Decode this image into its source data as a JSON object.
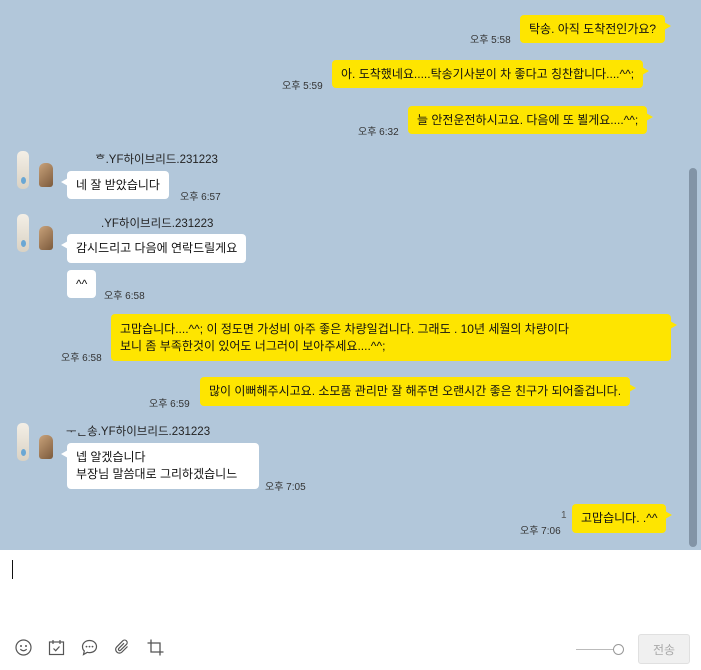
{
  "messages": {
    "m1": {
      "text": "탁송. 아직 도착전인가요?",
      "time": "오후 5:58"
    },
    "m2": {
      "text": "아. 도착했네요.....탁송기사분이   차 좋다고 칭찬합니다....^^;",
      "time": "오후 5:59"
    },
    "m3": {
      "text": "늘 안전운전하시고요. 다음에  또 뵐게요....^^;",
      "time": "오후 6:32"
    },
    "g1": {
      "sender": "ᄒ.YF하이브리드.231223",
      "text": "네 잘 받았습니다",
      "time": "오후 6:57"
    },
    "g2": {
      "sender": ".YF하이브리드.231223",
      "text1": "감시드리고 다음에 연락드릴게요",
      "text2": "^^",
      "time": "오후 6:58"
    },
    "m4": {
      "line1": "고맙습니다....^^;       이 정도면   가성비 아주 좋은 차량일겁니다.      그래도 . 10년 세월의 차량이다",
      "line2": "보니     좀 부족한것이 있어도  너그러이 보아주세요....^^;",
      "time": "오후 6:58"
    },
    "m5": {
      "text": "많이 이뻐해주시고요.   소모품 관리만 잘 해주면 오랜시간 좋은 친구가 되어줄겁니다.",
      "time": "오후 6:59"
    },
    "g3": {
      "sender": "ᅮᆫ송.YF하이브리드.231223",
      "line1": "넵 알겠습니다",
      "line2": "부장님 말씀대로 그리하겠습니느",
      "time": "오후 7:05"
    },
    "m6": {
      "text": "고맙습니다. .^^",
      "time": "오후 7:06",
      "unread": "1"
    }
  },
  "input": {
    "send_label": "전송",
    "tools": [
      "emoji-icon",
      "calendar-icon",
      "chat-bubble-icon",
      "paperclip-icon",
      "crop-icon"
    ]
  },
  "colors": {
    "chat_bg": "#b2c7da",
    "my_bubble": "#fee500",
    "other_bubble": "#ffffff",
    "scrollbar": "#8294a6"
  }
}
